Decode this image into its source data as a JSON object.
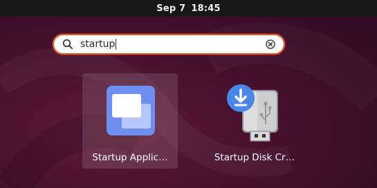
{
  "topbar": {
    "date": "Sep 7",
    "time": "18:45"
  },
  "search": {
    "query": "startup"
  },
  "apps": [
    {
      "label": "Startup Applic…",
      "icon": "startup-applications-icon",
      "selected": true
    },
    {
      "label": "Startup Disk Cr…",
      "icon": "startup-disk-creator-icon",
      "selected": false
    }
  ],
  "colors": {
    "accent": "#e95420",
    "topbar": "#171717",
    "background": "#4a1230",
    "startup_icon": "#6e8ef0",
    "download_badge": "#4a86e8"
  }
}
